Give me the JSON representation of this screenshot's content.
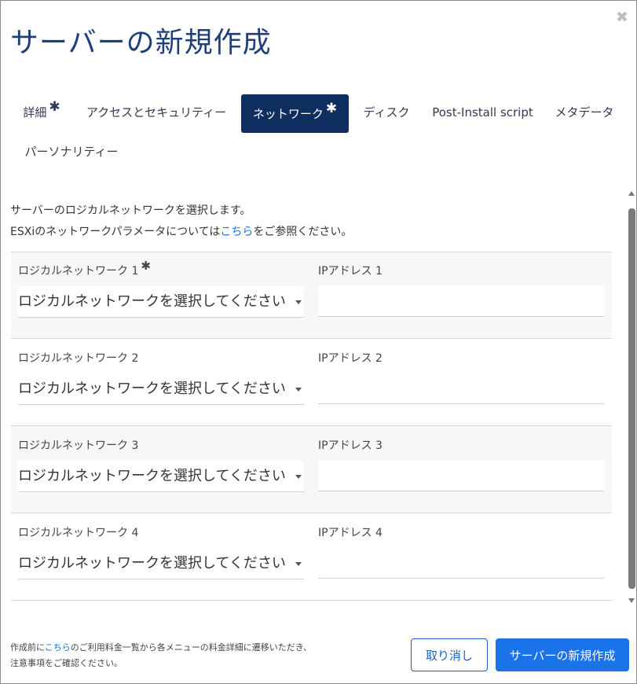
{
  "dialog": {
    "title": "サーバーの新規作成",
    "close_glyph": "✖"
  },
  "tabs": [
    {
      "label": "詳細",
      "required": "✱",
      "active": false
    },
    {
      "label": "アクセスとセキュリティー",
      "active": false
    },
    {
      "label": "ネットワーク",
      "required": "✱",
      "active": true
    },
    {
      "label": "ディスク",
      "active": false
    },
    {
      "label": "Post-Install script",
      "active": false
    },
    {
      "label": "メタデータ",
      "active": false
    },
    {
      "label": "パーソナリティー",
      "active": false
    }
  ],
  "intro": {
    "line1": "サーバーのロジカルネットワークを選択します。",
    "line2_prefix": "ESXiのネットワークパラメータについては",
    "line2_link": "こちら",
    "line2_suffix": "をご参照ください。"
  },
  "networks": [
    {
      "network_label": "ロジカルネットワーク 1",
      "required": "✱",
      "select_value": "ロジカルネットワークを選択してください",
      "ip_label": "IPアドレス 1",
      "ip_value": ""
    },
    {
      "network_label": "ロジカルネットワーク 2",
      "select_value": "ロジカルネットワークを選択してください",
      "ip_label": "IPアドレス 2",
      "ip_value": ""
    },
    {
      "network_label": "ロジカルネットワーク 3",
      "select_value": "ロジカルネットワークを選択してください",
      "ip_label": "IPアドレス 3",
      "ip_value": ""
    },
    {
      "network_label": "ロジカルネットワーク 4",
      "select_value": "ロジカルネットワークを選択してください",
      "ip_label": "IPアドレス 4",
      "ip_value": ""
    }
  ],
  "footer": {
    "note_prefix": "作成前に",
    "note_link": "こちら",
    "note_suffix": "のご利用料金一覧から各メニューの料金詳細に遷移いただき、",
    "note_line2": "注意事項をご確認ください。",
    "cancel_label": "取り消し",
    "create_label": "サーバーの新規作成"
  },
  "colors": {
    "title": "#1f3f7a",
    "active_tab_bg": "#0d2e5f",
    "primary_button": "#1a73e8",
    "link": "#1a73e8"
  }
}
